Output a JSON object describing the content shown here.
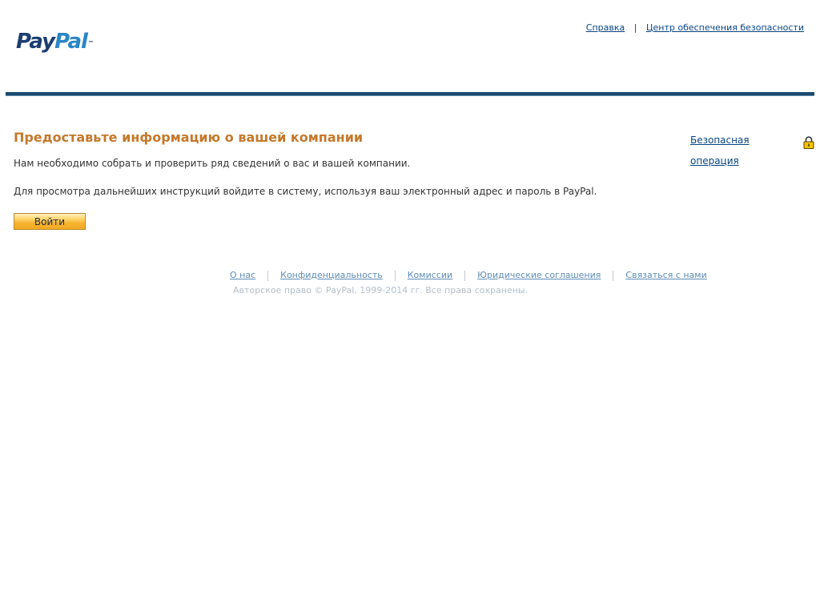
{
  "header": {
    "logo": {
      "pay": "Pay",
      "pal": "Pal",
      "tm": "™"
    },
    "links": {
      "help": "Справка",
      "separator": "|",
      "security_center": "Центр обеспечения безопасности"
    }
  },
  "main": {
    "title": "Предоставьте информацию о вашей компании",
    "intro": "Нам необходимо собрать и проверить ряд сведений о вас и вашей компании.",
    "instructions": "Для просмотра дальнейших инструкций войдите в систему, используя ваш электронный адрес и пароль в PayPal.",
    "login_button": "Войти",
    "secure_transaction": "Безопасная операция",
    "lock_icon": "padlock-icon"
  },
  "footer": {
    "links": {
      "about": "О нас",
      "privacy": "Конфиденциальность",
      "fees": "Комиссии",
      "legal": "Юридические соглашения",
      "contact": "Связаться с нами"
    },
    "copyright": "Авторское право © PayPal, 1999-2014 гг. Все права сохранены."
  },
  "colors": {
    "title": "#c5782a",
    "link": "#084482",
    "header_rule": "#1c4a6e",
    "button": "#f7b432",
    "footer_link": "#5d8cb6",
    "copyright": "#b4bfc9"
  }
}
